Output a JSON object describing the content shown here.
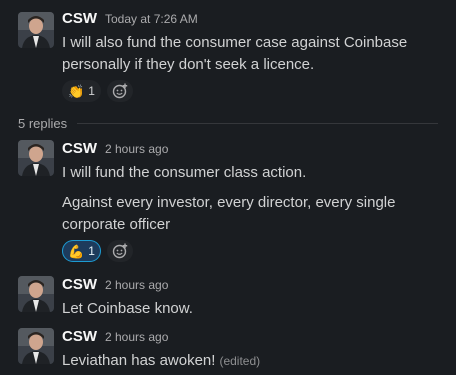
{
  "messages": [
    {
      "author": "CSW",
      "timestamp": "Today at 7:26 AM",
      "lines": [
        "I will also fund the consumer case against Coinbase personally if they don't seek a licence."
      ],
      "reactions": [
        {
          "emoji": "👏",
          "icon": "clap-icon",
          "count": "1",
          "active": false
        }
      ]
    },
    {
      "author": "CSW",
      "timestamp": "2 hours ago",
      "lines": [
        "I will fund the consumer class action.",
        "Against every investor, every director, every single corporate officer"
      ],
      "reactions": [
        {
          "emoji": "💪",
          "icon": "flexed-bicep-icon",
          "count": "1",
          "active": true
        }
      ]
    },
    {
      "author": "CSW",
      "timestamp": "2 hours ago",
      "lines": [
        "Let Coinbase know."
      ],
      "reactions": []
    },
    {
      "author": "CSW",
      "timestamp": "2 hours ago",
      "lines": [
        "Leviathan has awoken!"
      ],
      "edited": "(edited)",
      "reactions": []
    }
  ],
  "replies": {
    "label": "5 replies"
  },
  "colors": {
    "background": "#1a1d21",
    "active_reaction": "#1d9bd1",
    "text": "#d1d2d3"
  }
}
